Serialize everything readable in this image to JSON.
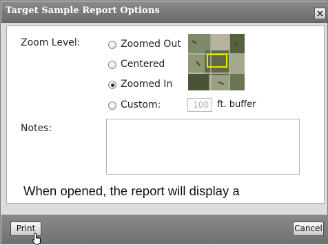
{
  "dialog": {
    "title": "Target Sample Report Options",
    "close_icon": "close-icon"
  },
  "zoom": {
    "label": "Zoom Level:",
    "options": [
      {
        "label": "Zoomed Out",
        "selected": false
      },
      {
        "label": "Centered",
        "selected": false
      },
      {
        "label": "Zoomed In",
        "selected": true
      },
      {
        "label": "Custom:",
        "selected": false
      }
    ],
    "buffer_value": "100",
    "buffer_unit": "ft. buffer",
    "preview": "aerial-map-thumbnail"
  },
  "notes": {
    "label": "Notes:",
    "value": ""
  },
  "info_text": "When opened, the report will display a",
  "footer": {
    "print_label": "Print",
    "cancel_label": "Cancel"
  },
  "colors": {
    "titlebar": "#7a7a7a",
    "footer": "#7c7c7c",
    "highlight_box": "#f5e600"
  }
}
